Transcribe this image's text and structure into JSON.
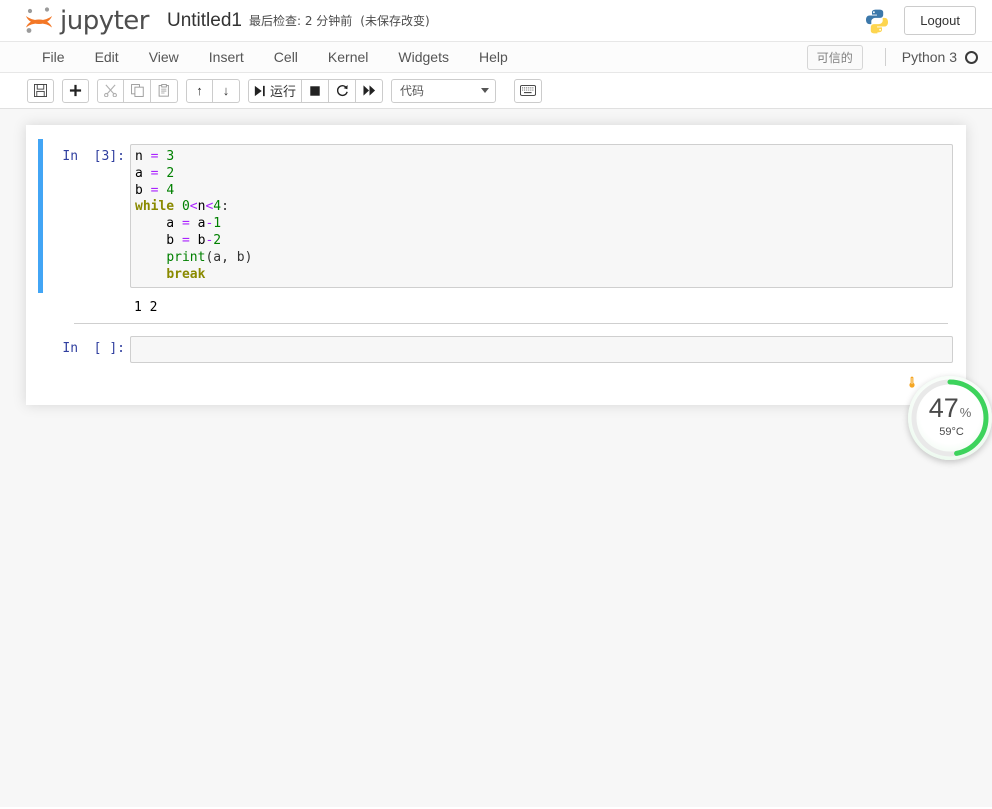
{
  "header": {
    "logo_text": "jupyter",
    "logo_icon": "jupyter-logo-icon",
    "notebook_name": "Untitled1",
    "checkpoint_status": "最后检查: 2 分钟前",
    "autosave_status": "(未保存改变)",
    "python_logo_icon": "python-logo-icon",
    "logout_label": "Logout"
  },
  "menubar": {
    "items": [
      {
        "label": "File"
      },
      {
        "label": "Edit"
      },
      {
        "label": "View"
      },
      {
        "label": "Insert"
      },
      {
        "label": "Cell"
      },
      {
        "label": "Kernel"
      },
      {
        "label": "Widgets"
      },
      {
        "label": "Help"
      }
    ],
    "trust_badge": "可信的",
    "kernel_name": "Python 3",
    "kernel_indicator": "kernel-idle-circle-icon"
  },
  "toolbar": {
    "save_label": "save-icon",
    "insert_label": "plus-icon",
    "cut_label": "scissors-icon",
    "copy_label": "copy-icon",
    "paste_label": "paste-icon",
    "move_up_label": "↑",
    "move_down_label": "↓",
    "run_label": "运行",
    "stop_label": "stop-square-icon",
    "restart_label": "restart-icon",
    "restart_run_all_label": "fast-forward-icon",
    "celltype_value": "代码",
    "command_palette_label": "keyboard-icon"
  },
  "notebook": {
    "cells": [
      {
        "prompt": "In  [3]:",
        "execution_count": "3",
        "type": "code",
        "source_lines": [
          [
            {
              "t": "n ",
              "c": "plain"
            },
            {
              "t": "=",
              "c": "operator"
            },
            {
              "t": " ",
              "c": "plain"
            },
            {
              "t": "3",
              "c": "number"
            }
          ],
          [
            {
              "t": "a ",
              "c": "plain"
            },
            {
              "t": "=",
              "c": "operator"
            },
            {
              "t": " ",
              "c": "plain"
            },
            {
              "t": "2",
              "c": "number"
            }
          ],
          [
            {
              "t": "b ",
              "c": "plain"
            },
            {
              "t": "=",
              "c": "operator"
            },
            {
              "t": " ",
              "c": "plain"
            },
            {
              "t": "4",
              "c": "number"
            }
          ],
          [
            {
              "t": "while",
              "c": "keyword"
            },
            {
              "t": " ",
              "c": "plain"
            },
            {
              "t": "0",
              "c": "number"
            },
            {
              "t": "<",
              "c": "operator"
            },
            {
              "t": "n",
              "c": "plain"
            },
            {
              "t": "<",
              "c": "operator"
            },
            {
              "t": "4",
              "c": "number"
            },
            {
              "t": ":",
              "c": "punct"
            }
          ],
          [
            {
              "t": "    a ",
              "c": "plain"
            },
            {
              "t": "=",
              "c": "operator"
            },
            {
              "t": " a",
              "c": "plain"
            },
            {
              "t": "-",
              "c": "operator"
            },
            {
              "t": "1",
              "c": "number"
            }
          ],
          [
            {
              "t": "    b ",
              "c": "plain"
            },
            {
              "t": "=",
              "c": "operator"
            },
            {
              "t": " b",
              "c": "plain"
            },
            {
              "t": "-",
              "c": "operator"
            },
            {
              "t": "2",
              "c": "number"
            }
          ],
          [
            {
              "t": "    ",
              "c": "plain"
            },
            {
              "t": "print",
              "c": "builtin"
            },
            {
              "t": "(a, b)",
              "c": "punct"
            }
          ],
          [
            {
              "t": "    ",
              "c": "plain"
            },
            {
              "t": "break",
              "c": "keyword"
            }
          ]
        ],
        "output_text": "1 2",
        "selected": true
      },
      {
        "prompt": "In  [ ]:",
        "execution_count": "",
        "type": "code",
        "source_lines": [],
        "output_text": "",
        "selected": false
      }
    ]
  },
  "cpu_widget": {
    "percent": "47",
    "percent_sign": "%",
    "temperature": "59°C",
    "thermometer_icon": "thermometer-icon",
    "ring_color": "#3dd35c",
    "ring_fraction": 0.47
  },
  "colors": {
    "accent_blue": "#42a5f5",
    "prompt_blue": "#303f9f",
    "jupyter_orange": "#f37726",
    "page_bg": "#f7f7f7",
    "ring_green": "#3dd35c"
  }
}
